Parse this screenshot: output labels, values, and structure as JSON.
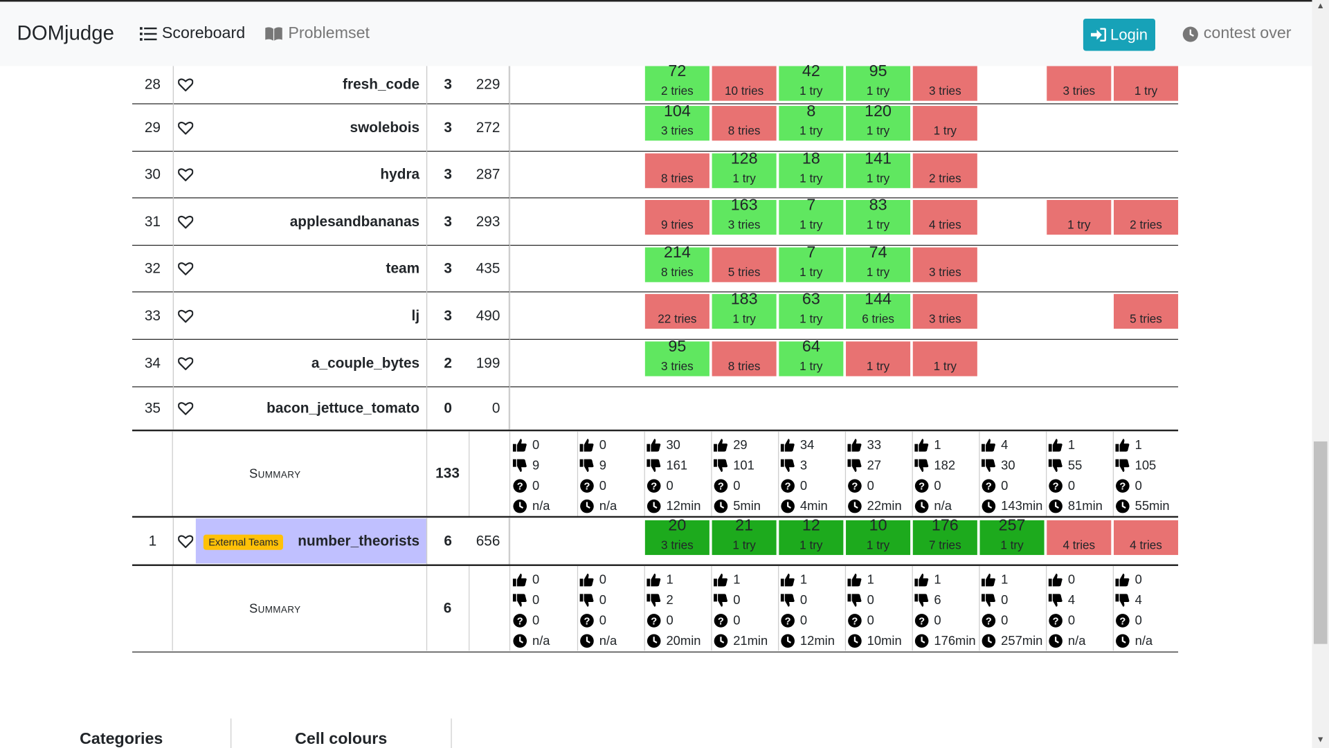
{
  "nav": {
    "brand": "DOMjudge",
    "scoreboard": "Scoreboard",
    "problemset": "Problemset",
    "login": "Login",
    "status": "contest over"
  },
  "icons": {
    "scoreboard": "list-icon",
    "problemset": "book-icon",
    "login": "sign-in-icon",
    "status": "clock-icon",
    "favourite": "heart-icon"
  },
  "colors": {
    "solved": "#60e760",
    "first_solve": "#1daa1d",
    "failed": "#e87272",
    "login": "#17a2b8",
    "team_highlight": "#c0c0ff",
    "badge": "#ffc107"
  },
  "teams": [
    {
      "rank": "28",
      "name": "fresh_code",
      "solved": "3",
      "score": "229",
      "cells": [
        null,
        null,
        {
          "s": "sol",
          "t": "72",
          "tr": "2 tries"
        },
        {
          "s": "fail",
          "t": "",
          "tr": "10 tries"
        },
        {
          "s": "sol",
          "t": "42",
          "tr": "1 try"
        },
        {
          "s": "sol",
          "t": "95",
          "tr": "1 try"
        },
        {
          "s": "fail",
          "t": "",
          "tr": "3 tries"
        },
        null,
        {
          "s": "fail",
          "t": "",
          "tr": "3 tries"
        },
        {
          "s": "fail",
          "t": "",
          "tr": "1 try"
        }
      ]
    },
    {
      "rank": "29",
      "name": "swolebois",
      "solved": "3",
      "score": "272",
      "cells": [
        null,
        null,
        {
          "s": "sol",
          "t": "104",
          "tr": "3 tries"
        },
        {
          "s": "fail",
          "t": "",
          "tr": "8 tries"
        },
        {
          "s": "sol",
          "t": "8",
          "tr": "1 try"
        },
        {
          "s": "sol",
          "t": "120",
          "tr": "1 try"
        },
        {
          "s": "fail",
          "t": "",
          "tr": "1 try"
        },
        null,
        null,
        null
      ]
    },
    {
      "rank": "30",
      "name": "hydra",
      "solved": "3",
      "score": "287",
      "cells": [
        null,
        null,
        {
          "s": "fail",
          "t": "",
          "tr": "8 tries"
        },
        {
          "s": "sol",
          "t": "128",
          "tr": "1 try"
        },
        {
          "s": "sol",
          "t": "18",
          "tr": "1 try"
        },
        {
          "s": "sol",
          "t": "141",
          "tr": "1 try"
        },
        {
          "s": "fail",
          "t": "",
          "tr": "2 tries"
        },
        null,
        null,
        null
      ]
    },
    {
      "rank": "31",
      "name": "applesandbananas",
      "solved": "3",
      "score": "293",
      "cells": [
        null,
        null,
        {
          "s": "fail",
          "t": "",
          "tr": "9 tries"
        },
        {
          "s": "sol",
          "t": "163",
          "tr": "3 tries"
        },
        {
          "s": "sol",
          "t": "7",
          "tr": "1 try"
        },
        {
          "s": "sol",
          "t": "83",
          "tr": "1 try"
        },
        {
          "s": "fail",
          "t": "",
          "tr": "4 tries"
        },
        null,
        {
          "s": "fail",
          "t": "",
          "tr": "1 try"
        },
        {
          "s": "fail",
          "t": "",
          "tr": "2 tries"
        }
      ]
    },
    {
      "rank": "32",
      "name": "team",
      "solved": "3",
      "score": "435",
      "cells": [
        null,
        null,
        {
          "s": "sol",
          "t": "214",
          "tr": "8 tries"
        },
        {
          "s": "fail",
          "t": "",
          "tr": "5 tries"
        },
        {
          "s": "sol",
          "t": "7",
          "tr": "1 try"
        },
        {
          "s": "sol",
          "t": "74",
          "tr": "1 try"
        },
        {
          "s": "fail",
          "t": "",
          "tr": "3 tries"
        },
        null,
        null,
        null
      ]
    },
    {
      "rank": "33",
      "name": "lj",
      "solved": "3",
      "score": "490",
      "cells": [
        null,
        null,
        {
          "s": "fail",
          "t": "",
          "tr": "22 tries"
        },
        {
          "s": "sol",
          "t": "183",
          "tr": "1 try"
        },
        {
          "s": "sol",
          "t": "63",
          "tr": "1 try"
        },
        {
          "s": "sol",
          "t": "144",
          "tr": "6 tries"
        },
        {
          "s": "fail",
          "t": "",
          "tr": "3 tries"
        },
        null,
        null,
        {
          "s": "fail",
          "t": "",
          "tr": "5 tries"
        }
      ]
    },
    {
      "rank": "34",
      "name": "a_couple_bytes",
      "solved": "2",
      "score": "199",
      "cells": [
        null,
        null,
        {
          "s": "sol",
          "t": "95",
          "tr": "3 tries"
        },
        {
          "s": "fail",
          "t": "",
          "tr": "8 tries"
        },
        {
          "s": "sol",
          "t": "64",
          "tr": "1 try"
        },
        {
          "s": "fail",
          "t": "",
          "tr": "1 try"
        },
        {
          "s": "fail",
          "t": "",
          "tr": "1 try"
        },
        null,
        null,
        null
      ]
    },
    {
      "rank": "35",
      "name": "bacon_jettuce_tomato",
      "solved": "0",
      "score": "0",
      "cells": [
        null,
        null,
        null,
        null,
        null,
        null,
        null,
        null,
        null,
        null
      ]
    }
  ],
  "summary1": {
    "label": "Summary",
    "total": "133",
    "stats": [
      [
        "0",
        "9",
        "0",
        "n/a"
      ],
      [
        "0",
        "9",
        "0",
        "n/a"
      ],
      [
        "30",
        "161",
        "0",
        "12min"
      ],
      [
        "29",
        "101",
        "0",
        "5min"
      ],
      [
        "34",
        "3",
        "0",
        "4min"
      ],
      [
        "33",
        "27",
        "0",
        "22min"
      ],
      [
        "1",
        "182",
        "0",
        "n/a"
      ],
      [
        "4",
        "30",
        "0",
        "143min"
      ],
      [
        "1",
        "55",
        "0",
        "81min"
      ],
      [
        "1",
        "105",
        "0",
        "55min"
      ]
    ]
  },
  "external_team": {
    "rank": "1",
    "badge": "External Teams",
    "name": "number_theorists",
    "solved": "6",
    "score": "656",
    "cells": [
      null,
      null,
      {
        "s": "fs",
        "t": "20",
        "tr": "3 tries"
      },
      {
        "s": "fs",
        "t": "21",
        "tr": "1 try"
      },
      {
        "s": "fs",
        "t": "12",
        "tr": "1 try"
      },
      {
        "s": "fs",
        "t": "10",
        "tr": "1 try"
      },
      {
        "s": "fs",
        "t": "176",
        "tr": "7 tries"
      },
      {
        "s": "fs",
        "t": "257",
        "tr": "1 try"
      },
      {
        "s": "fail",
        "t": "",
        "tr": "4 tries"
      },
      {
        "s": "fail",
        "t": "",
        "tr": "4 tries"
      }
    ]
  },
  "summary2": {
    "label": "Summary",
    "total": "6",
    "stats": [
      [
        "0",
        "0",
        "0",
        "n/a"
      ],
      [
        "0",
        "0",
        "0",
        "n/a"
      ],
      [
        "1",
        "2",
        "0",
        "20min"
      ],
      [
        "1",
        "0",
        "0",
        "21min"
      ],
      [
        "1",
        "0",
        "0",
        "12min"
      ],
      [
        "1",
        "0",
        "0",
        "10min"
      ],
      [
        "1",
        "6",
        "0",
        "176min"
      ],
      [
        "1",
        "0",
        "0",
        "257min"
      ],
      [
        "0",
        "4",
        "0",
        "n/a"
      ],
      [
        "0",
        "4",
        "0",
        "n/a"
      ]
    ]
  },
  "legend": {
    "categories": "Categories",
    "cell_colours": "Cell colours"
  }
}
